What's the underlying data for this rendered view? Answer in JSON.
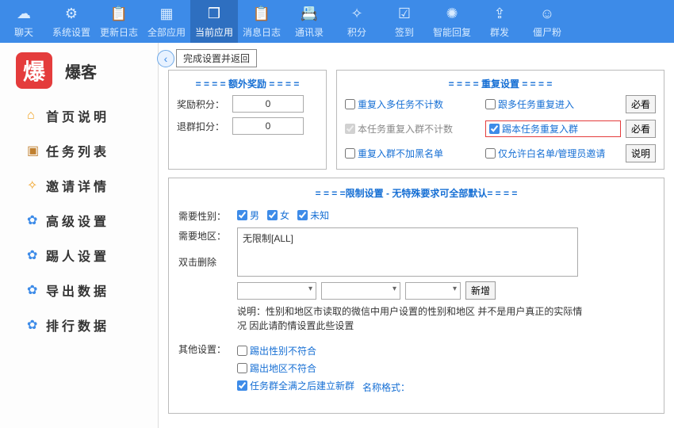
{
  "nav": {
    "items": [
      {
        "icon": "☁",
        "label": "聊天"
      },
      {
        "icon": "⚙",
        "label": "系统设置"
      },
      {
        "icon": "📋",
        "label": "更新日志"
      },
      {
        "icon": "▦",
        "label": "全部应用"
      },
      {
        "icon": "❒",
        "label": "当前应用"
      },
      {
        "icon": "📋",
        "label": "消息日志"
      },
      {
        "icon": "📇",
        "label": "通讯录"
      },
      {
        "icon": "✧",
        "label": "积分"
      },
      {
        "icon": "☑",
        "label": "签到"
      },
      {
        "icon": "✺",
        "label": "智能回复"
      },
      {
        "icon": "⇪",
        "label": "群发"
      },
      {
        "icon": "☺",
        "label": "僵尸粉"
      }
    ],
    "activeIndex": 4
  },
  "brand": {
    "logo": "爆",
    "name": "爆客"
  },
  "sidebar": {
    "items": [
      {
        "icon": "⌂",
        "color": "#f0a020",
        "label": "首页说明"
      },
      {
        "icon": "▣",
        "color": "#c08030",
        "label": "任务列表"
      },
      {
        "icon": "✧",
        "color": "#f0a020",
        "label": "邀请详情"
      },
      {
        "icon": "✿",
        "color": "#3d8be8",
        "label": "高级设置"
      },
      {
        "icon": "✿",
        "color": "#3d8be8",
        "label": "踢人设置"
      },
      {
        "icon": "✿",
        "color": "#3d8be8",
        "label": "导出数据"
      },
      {
        "icon": "✿",
        "color": "#3d8be8",
        "label": "排行数据"
      }
    ]
  },
  "back_button": "完成设置并返回",
  "bonus": {
    "title": "= = = = 额外奖励 = = = =",
    "reward_label": "奖励积分：",
    "reward_value": "0",
    "deduct_label": "退群扣分：",
    "deduct_value": "0"
  },
  "dup": {
    "title": "= = = = 重复设置 = = = =",
    "opt1": "重复入多任务不计数",
    "opt2": "跟多任务重复进入",
    "opt3": "本任务重复入群不计数",
    "opt4": "踢本任务重复入群",
    "opt5": "重复入群不加黑名单",
    "opt6": "仅允许白名单/管理员邀请",
    "btn_view": "必看",
    "btn_desc": "说明"
  },
  "limit": {
    "title": "= = = =限制设置 - 无特殊要求可全部默认= = = =",
    "gender_label": "需要性别：",
    "gender_m": "男",
    "gender_f": "女",
    "gender_u": "未知",
    "region_label": "需要地区：",
    "region_value": "无限制[ALL]",
    "dbl_label": "双击删除",
    "add_btn": "新增",
    "desc": "说明：性别和地区市读取的微信中用户设置的性别和地区 并不是用户真正的实际情况 因此请酌情设置此些设置",
    "other_label": "其他设置：",
    "other1": "踢出性别不符合",
    "other2": "踢出地区不符合",
    "other3_a": "任务群全满之后建立新群",
    "other3_b": "名称格式："
  }
}
